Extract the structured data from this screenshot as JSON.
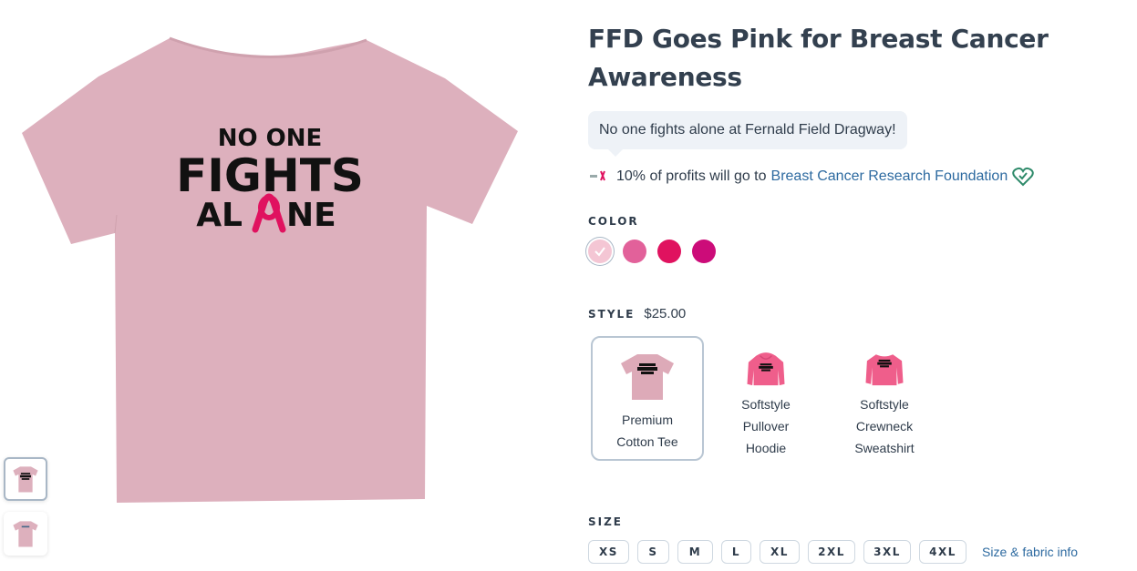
{
  "product": {
    "title": "FFD Goes Pink for Breast Cancer Awareness",
    "tagline": "No one fights alone at Fernald Field Dragway!",
    "donation_text": "10% of profits will go to",
    "donation_link": "Breast Cancer Research Foundation"
  },
  "artwork": {
    "line1": "NO ONE",
    "line2": "FIGHTS",
    "line3_a": "AL",
    "line3_b": "NE"
  },
  "color": {
    "label": "COLOR",
    "swatches": [
      {
        "hex": "#f4c6d4",
        "selected": true
      },
      {
        "hex": "#e2619a",
        "selected": false
      },
      {
        "hex": "#e0125f",
        "selected": false
      },
      {
        "hex": "#cc0c79",
        "selected": false
      }
    ]
  },
  "style": {
    "label": "STYLE",
    "price": "$25.00",
    "options": [
      {
        "name": "Premium Cotton Tee",
        "selected": true,
        "garment_color": "#ddaab8"
      },
      {
        "name": "Softstyle Pullover Hoodie",
        "selected": false,
        "garment_color": "#ef5e8b"
      },
      {
        "name": "Softstyle Crewneck Sweatshirt",
        "selected": false,
        "garment_color": "#ef5e8b"
      }
    ]
  },
  "size": {
    "label": "SIZE",
    "options": [
      "XS",
      "S",
      "M",
      "L",
      "XL",
      "2XL",
      "3XL",
      "4XL"
    ],
    "info_link": "Size & fabric info"
  },
  "colors": {
    "shirt": "#ddb0bd",
    "accent_link": "#2d6aa0",
    "heart": "#2e8a6a",
    "ribbon": "#e0125f"
  }
}
